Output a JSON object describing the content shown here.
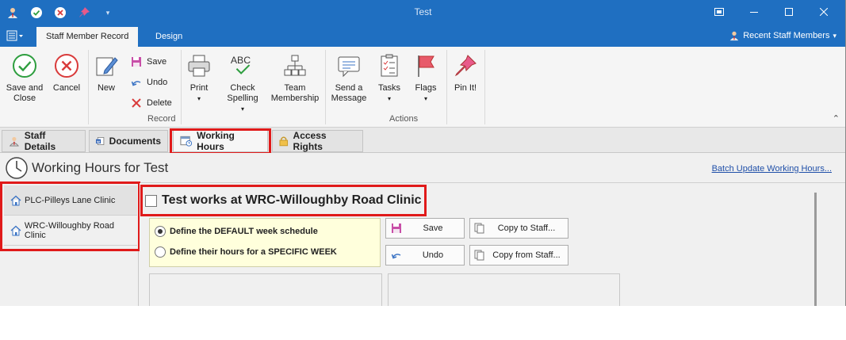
{
  "window": {
    "title": "Test"
  },
  "ribbon_tabs": [
    {
      "label": "Staff Member Record",
      "active": true
    },
    {
      "label": "Design",
      "active": false
    }
  ],
  "recent_staff": "Recent Staff Members",
  "ribbon": {
    "save_close": "Save and Close",
    "cancel": "Cancel",
    "new": "New",
    "save": "Save",
    "undo": "Undo",
    "delete": "Delete",
    "print": "Print",
    "check_spelling": "Check Spelling",
    "team_membership": "Team Membership",
    "send_message": "Send a Message",
    "tasks": "Tasks",
    "flags": "Flags",
    "pin_it": "Pin It!",
    "group_record": "Record",
    "group_actions": "Actions"
  },
  "doc_tabs": [
    {
      "label": "Staff Details"
    },
    {
      "label": "Documents"
    },
    {
      "label": "Working Hours"
    },
    {
      "label": "Access Rights"
    }
  ],
  "header": {
    "title": "Working Hours for Test",
    "batch_link": "Batch Update Working Hours..."
  },
  "clinics": [
    {
      "label": "PLC-Pilleys Lane Clinic"
    },
    {
      "label": "WRC-Willoughby Road Clinic"
    }
  ],
  "works_at": "Test works at WRC-Willoughby Road Clinic",
  "schedule": {
    "option_default": "Define the DEFAULT week schedule",
    "option_specific": "Define their hours for a SPECIFIC WEEK",
    "selected": "default"
  },
  "actions": {
    "save": "Save",
    "undo": "Undo",
    "copy_to": "Copy to Staff...",
    "copy_from": "Copy from Staff..."
  },
  "colors": {
    "titlebar": "#1f6fc1",
    "highlight_box": "#e01a1a",
    "check_green": "#2e9e3f",
    "cancel_red": "#d93b3b"
  }
}
